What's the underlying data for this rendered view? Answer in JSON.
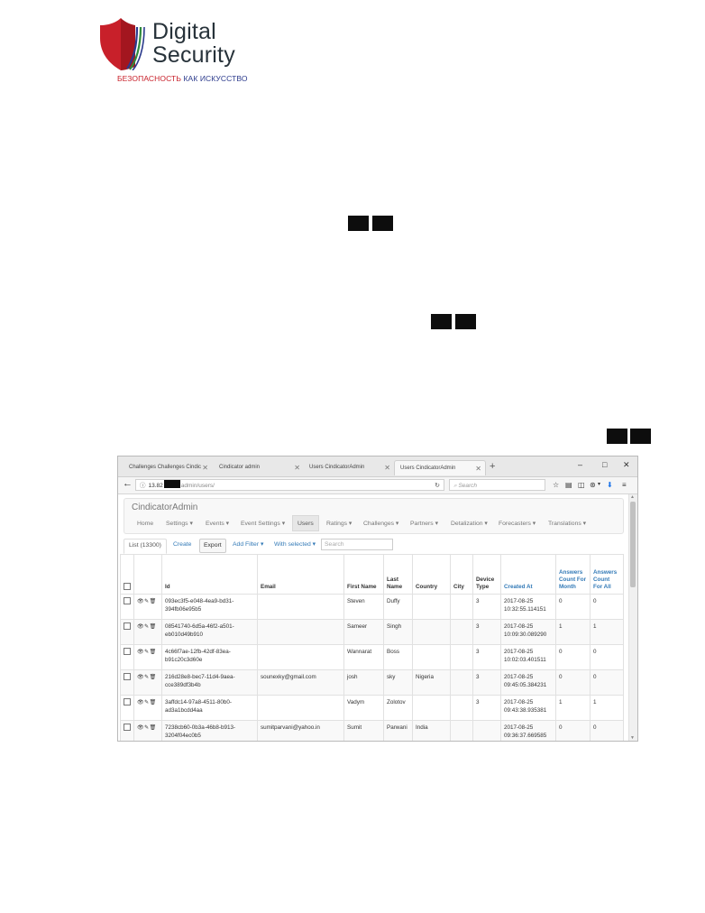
{
  "logo": {
    "line1": "Digital",
    "line2": "Security",
    "tagline_red": "БЕЗОПАСНОСТЬ",
    "tagline_blue": "КАК ИСКУССТВО",
    "colors": {
      "red": "#c8202a",
      "blue": "#2b3a8c",
      "green": "#2f8a3c",
      "text": "#27323a"
    }
  },
  "browser": {
    "tabs": [
      {
        "label": "Challenges  Challenges  Cindic"
      },
      {
        "label": "Cindicator admin"
      },
      {
        "label": "Users  CindicatorAdmin"
      },
      {
        "label": "Users  CindicatorAdmin"
      }
    ],
    "new_tab": "+",
    "window_controls": {
      "minimize": "–",
      "maximize": "□",
      "close": "✕"
    },
    "url": {
      "prefix": "13.82",
      "path": "admin/users/"
    },
    "search_placeholder": "Search"
  },
  "app": {
    "brand": "CindicatorAdmin",
    "menu": [
      {
        "label": "Home"
      },
      {
        "label": "Settings ▾"
      },
      {
        "label": "Events ▾"
      },
      {
        "label": "Event Settings ▾"
      },
      {
        "label": "Users"
      },
      {
        "label": "Ratings ▾"
      },
      {
        "label": "Challenges ▾"
      },
      {
        "label": "Partners ▾"
      },
      {
        "label": "Detalization ▾"
      },
      {
        "label": "Forecasters ▾"
      },
      {
        "label": "Translations ▾"
      }
    ],
    "toolbar": {
      "list_tab": "List (13300)",
      "create": "Create",
      "export": "Export",
      "add_filter": "Add Filter ▾",
      "with_selected": "With selected ▾",
      "search_placeholder": "Search"
    },
    "table": {
      "headers": [
        "Id",
        "Email",
        "First Name",
        "Last Name",
        "Country",
        "City",
        "Device Type",
        "Created At",
        "Answers Count For Month",
        "Answers Count For All"
      ],
      "rows": [
        {
          "id": "093ec3f5-e048-4ea9-bd31-394fb06e95b5",
          "email": "",
          "first": "Steven",
          "last": "Duffy",
          "country": "",
          "city": "",
          "device": "3",
          "created": "2017-08-25 10:32:55.114151",
          "month": "0",
          "all": "0"
        },
        {
          "id": "08541740-6d5a-46f2-a501-eb010d49b910",
          "email": "",
          "first": "Sameer",
          "last": "Singh",
          "country": "",
          "city": "",
          "device": "3",
          "created": "2017-08-25 10:09:30.089290",
          "month": "1",
          "all": "1"
        },
        {
          "id": "4c66f7ae-12fb-42df-83ea-b91c20c3d60e",
          "email": "",
          "first": "Wannarat",
          "last": "Boss",
          "country": "",
          "city": "",
          "device": "3",
          "created": "2017-08-25 10:02:03.401511",
          "month": "0",
          "all": "0"
        },
        {
          "id": "216d28e8-bec7-11d4-9aea-cce389df3b4b",
          "email": "sounexky@gmail.com",
          "first": "josh",
          "last": "sky",
          "country": "Nigeria",
          "city": "",
          "device": "3",
          "created": "2017-08-25 09:45:05.384231",
          "month": "0",
          "all": "0"
        },
        {
          "id": "3affdc14-97a8-4511-80b0-ad3a1bcdd4aa",
          "email": "",
          "first": "Vadym",
          "last": "Zolotov",
          "country": "",
          "city": "",
          "device": "3",
          "created": "2017-08-25 09:43:38.935381",
          "month": "1",
          "all": "1"
        },
        {
          "id": "7238cb60-0b3a-46b8-b913-3204f04ec0b5",
          "email": "sumitparvani@yahoo.in",
          "first": "Sumit",
          "last": "Parwani",
          "country": "India",
          "city": "",
          "device": "",
          "created": "2017-08-25 09:36:37.669585",
          "month": "0",
          "all": "0"
        }
      ]
    }
  }
}
